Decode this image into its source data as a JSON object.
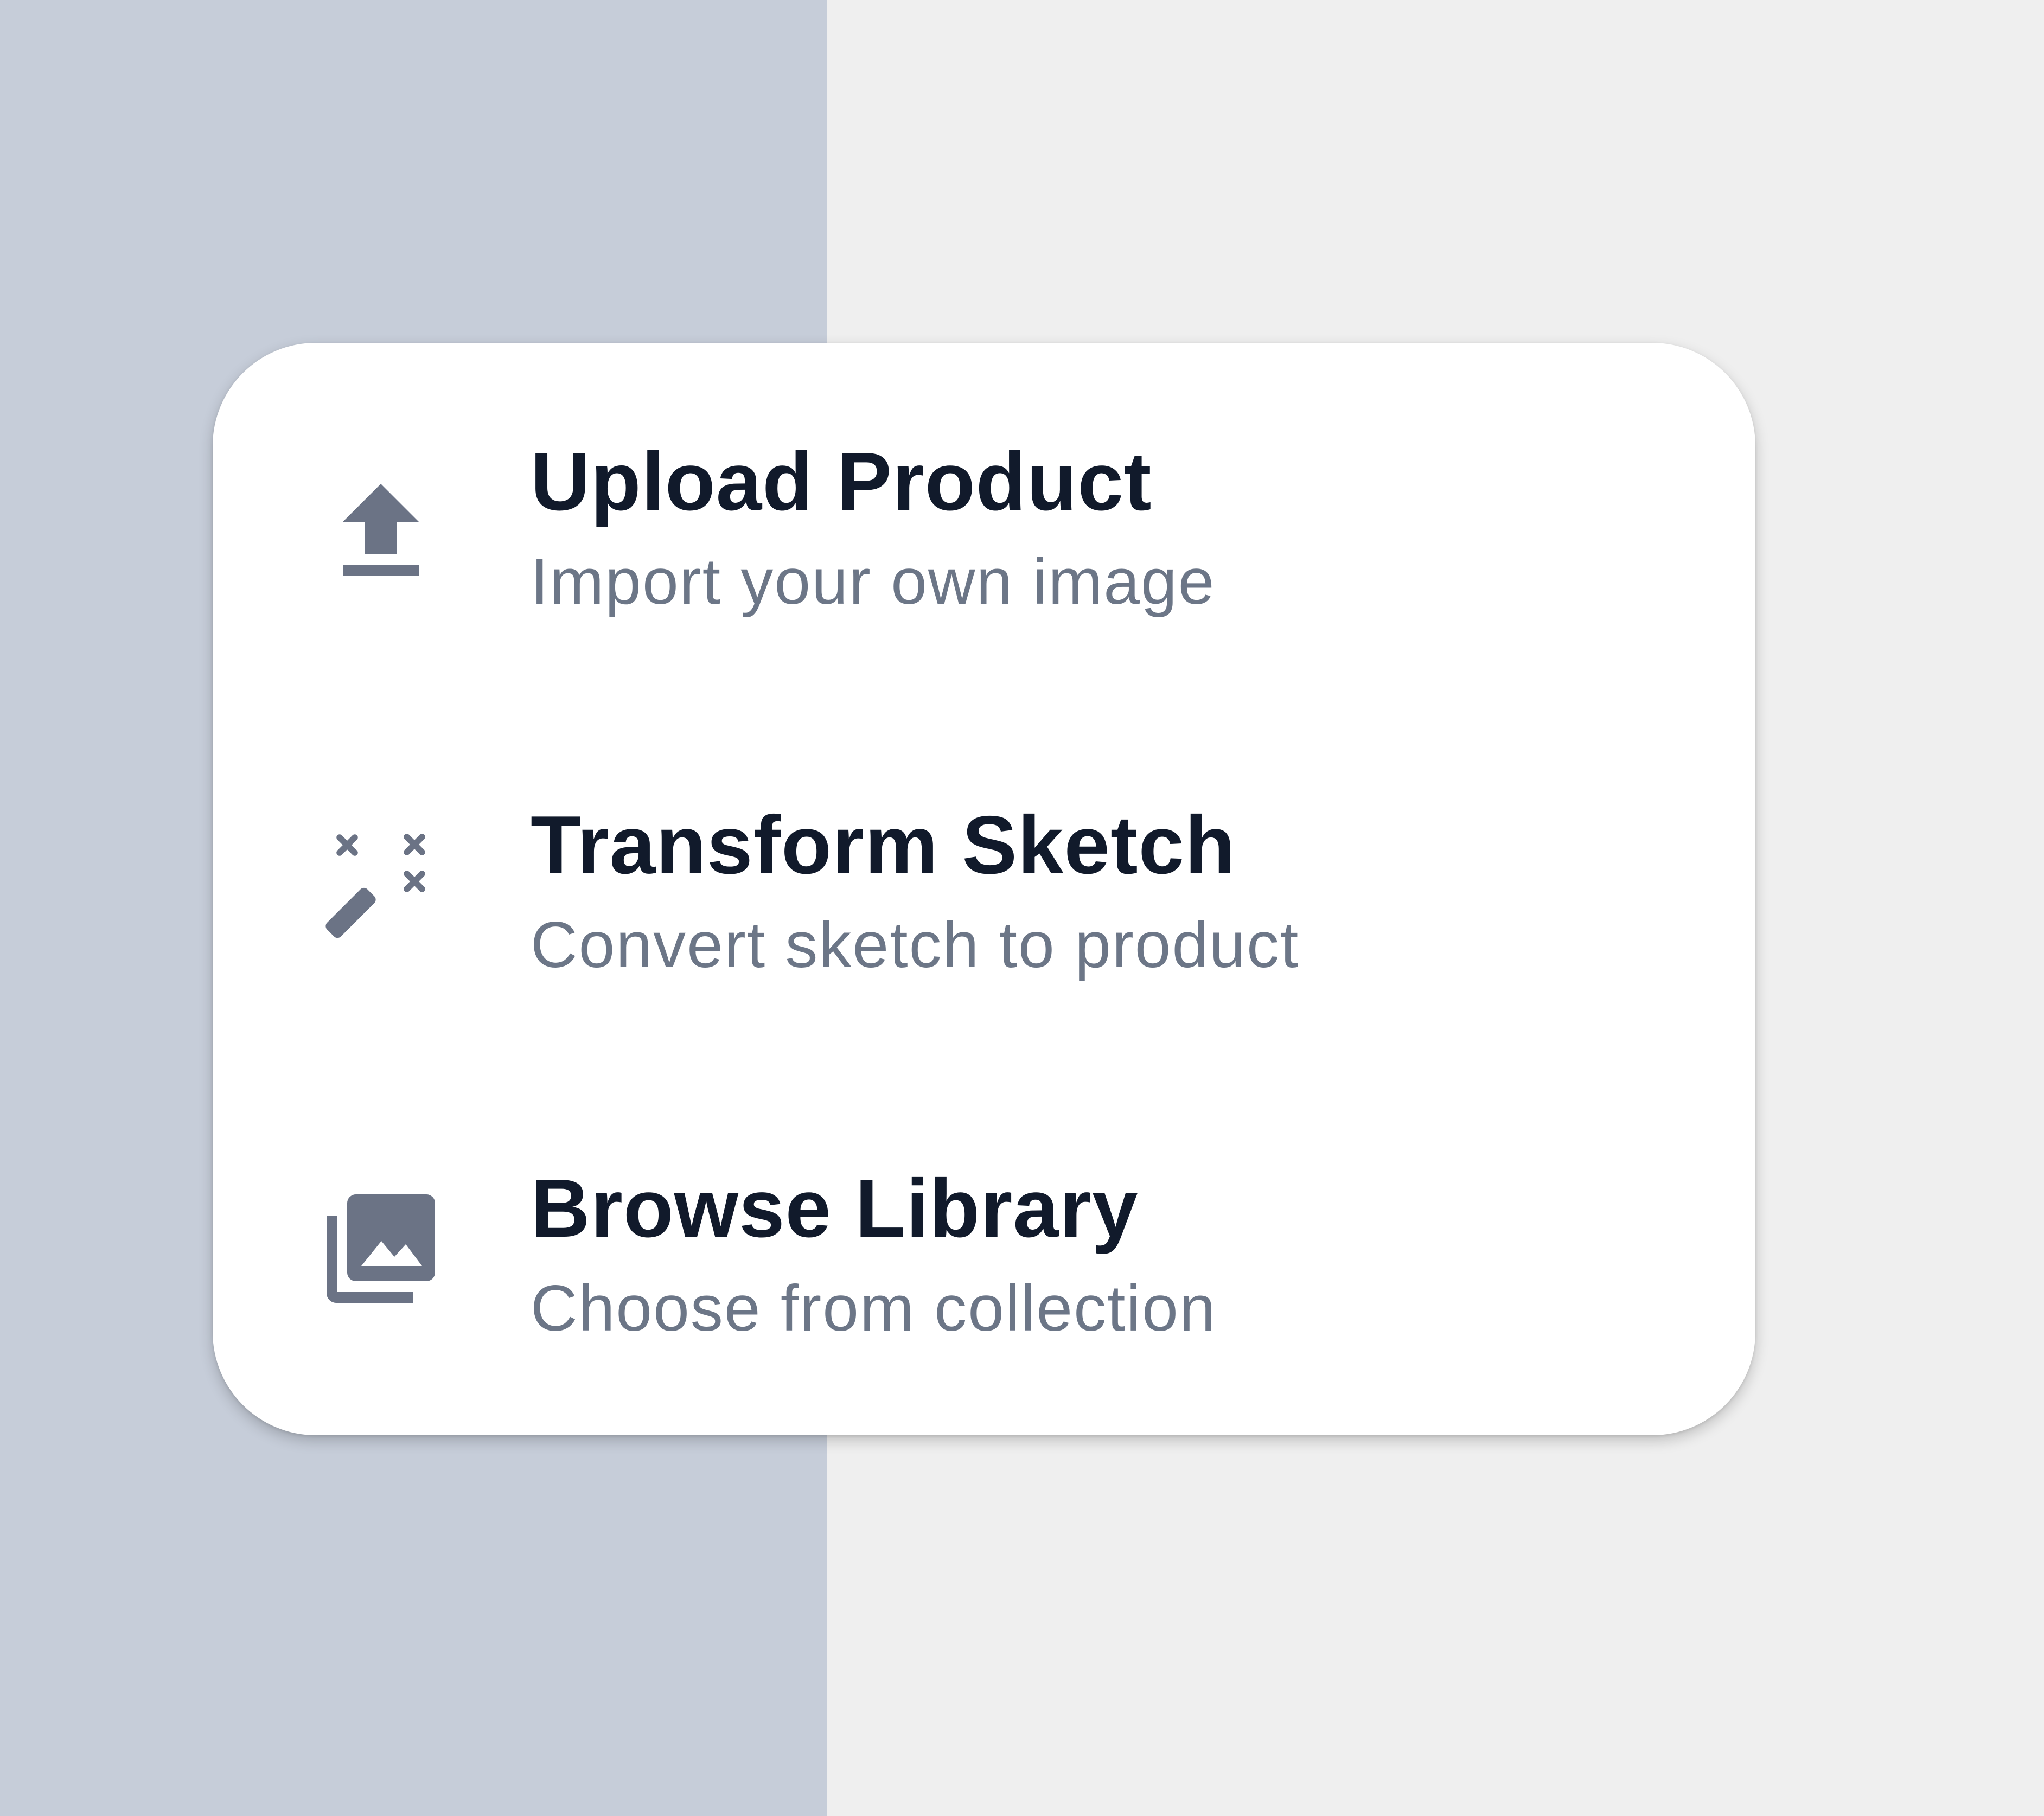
{
  "menu": {
    "items": [
      {
        "title": "Upload Product",
        "subtitle": "Import your own image",
        "icon": "upload-icon"
      },
      {
        "title": "Transform Sketch",
        "subtitle": "Convert sketch to product",
        "icon": "magic-wand-icon"
      },
      {
        "title": "Browse Library",
        "subtitle": "Choose from collection",
        "icon": "photo-library-icon"
      }
    ]
  },
  "colors": {
    "left_background": "#c6cdd9",
    "right_background": "#efefef",
    "card_background": "#ffffff",
    "title_text": "#111a2b",
    "subtitle_text": "#6c7687",
    "icon": "#6b7385"
  }
}
